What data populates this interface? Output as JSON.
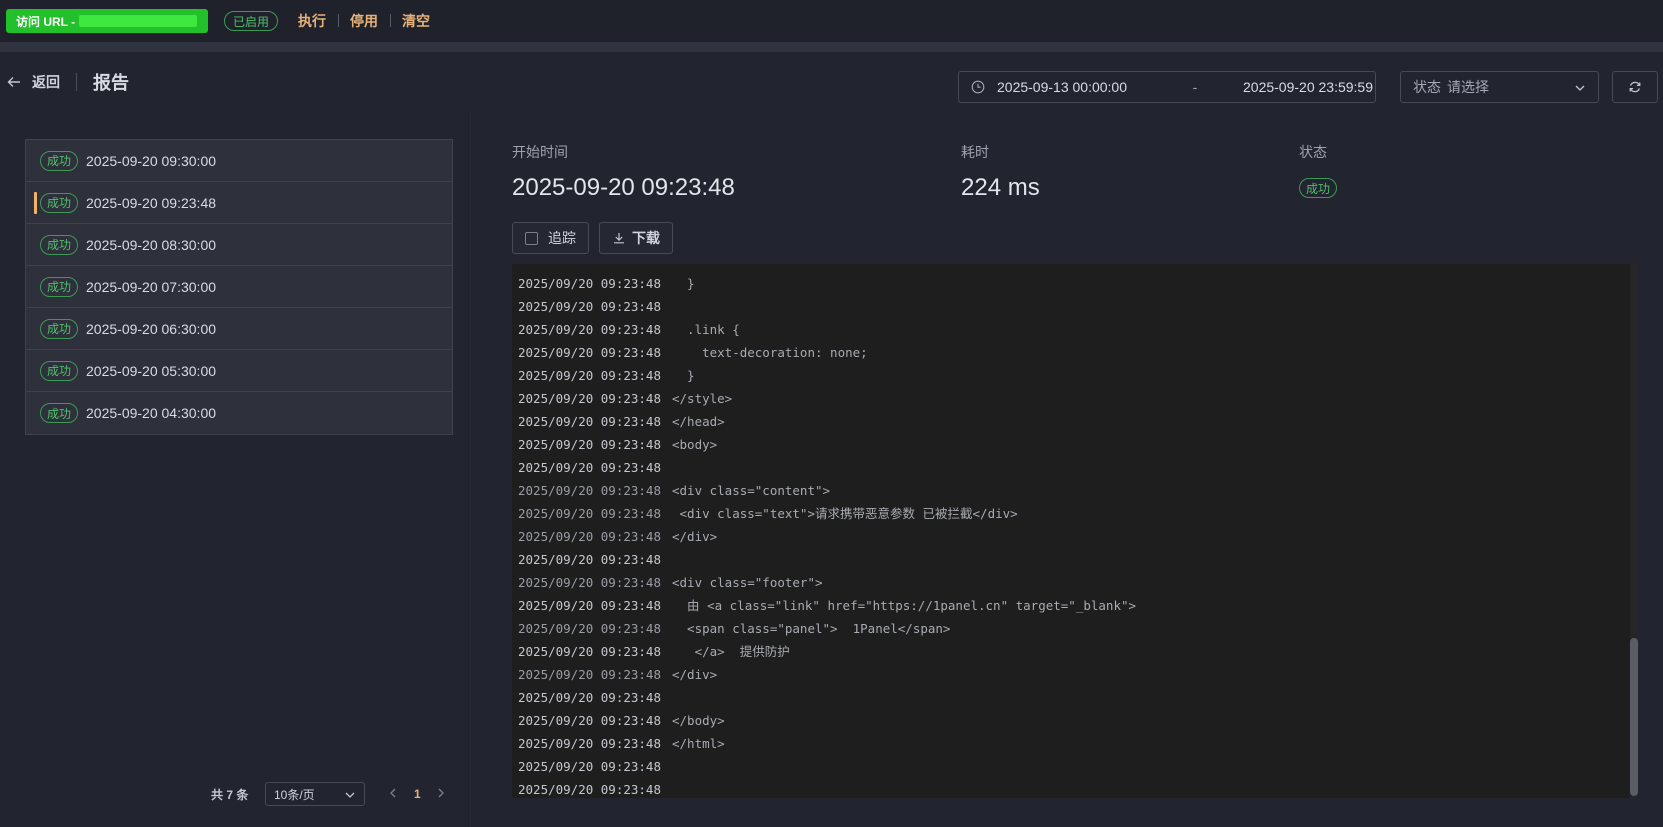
{
  "topbar": {
    "url_button": "访问 URL - ",
    "enabled_tag": "已启用",
    "actions": [
      "执行",
      "停用",
      "清空"
    ]
  },
  "header": {
    "back_label": "返回",
    "title": "报告",
    "date_start": "2025-09-13 00:00:00",
    "date_separator": "-",
    "date_end": "2025-09-20 23:59:59",
    "status_label": "状态",
    "status_placeholder": "请选择"
  },
  "records": [
    {
      "status": "成功",
      "time": "2025-09-20 09:30:00",
      "active": false
    },
    {
      "status": "成功",
      "time": "2025-09-20 09:23:48",
      "active": true
    },
    {
      "status": "成功",
      "time": "2025-09-20 08:30:00",
      "active": false
    },
    {
      "status": "成功",
      "time": "2025-09-20 07:30:00",
      "active": false
    },
    {
      "status": "成功",
      "time": "2025-09-20 06:30:00",
      "active": false
    },
    {
      "status": "成功",
      "time": "2025-09-20 05:30:00",
      "active": false
    },
    {
      "status": "成功",
      "time": "2025-09-20 04:30:00",
      "active": false
    }
  ],
  "pagination": {
    "total": "共 7 条",
    "page_size": "10条/页",
    "current_page": "1"
  },
  "details": {
    "start_label": "开始时间",
    "start_value": "2025-09-20 09:23:48",
    "duration_label": "耗时",
    "duration_value": "224 ms",
    "status_label": "状态",
    "status_value": "成功",
    "trace_label": "追踪",
    "download_label": "下载"
  },
  "log_lines": [
    {
      "ts": "2025/09/20 09:23:48",
      "text": "  }",
      "dim": false
    },
    {
      "ts": "2025/09/20 09:23:48",
      "text": "",
      "dim": false
    },
    {
      "ts": "2025/09/20 09:23:48",
      "text": "  .link {",
      "dim": false
    },
    {
      "ts": "2025/09/20 09:23:48",
      "text": "    text-decoration: none;",
      "dim": false
    },
    {
      "ts": "2025/09/20 09:23:48",
      "text": "  }",
      "dim": false
    },
    {
      "ts": "2025/09/20 09:23:48",
      "text": "</style>",
      "dim": false
    },
    {
      "ts": "2025/09/20 09:23:48",
      "text": "</head>",
      "dim": false
    },
    {
      "ts": "2025/09/20 09:23:48",
      "text": "<body>",
      "dim": false
    },
    {
      "ts": "2025/09/20 09:23:48",
      "text": "",
      "dim": false
    },
    {
      "ts": "2025/09/20 09:23:48",
      "text": "<div class=\"content\">",
      "dim": true
    },
    {
      "ts": "2025/09/20 09:23:48",
      "text": " <div class=\"text\">请求携带恶意参数 已被拦截</div>",
      "dim": true
    },
    {
      "ts": "2025/09/20 09:23:48",
      "text": "</div>",
      "dim": true
    },
    {
      "ts": "2025/09/20 09:23:48",
      "text": "",
      "dim": false
    },
    {
      "ts": "2025/09/20 09:23:48",
      "text": "<div class=\"footer\">",
      "dim": true
    },
    {
      "ts": "2025/09/20 09:23:48",
      "text": "  由 <a class=\"link\" href=\"https://1panel.cn\" target=\"_blank\">",
      "dim": false
    },
    {
      "ts": "2025/09/20 09:23:48",
      "text": "  <span class=\"panel\">  1Panel</span>",
      "dim": true
    },
    {
      "ts": "2025/09/20 09:23:48",
      "text": "   </a>  提供防护",
      "dim": false
    },
    {
      "ts": "2025/09/20 09:23:48",
      "text": "</div>",
      "dim": true
    },
    {
      "ts": "2025/09/20 09:23:48",
      "text": "",
      "dim": false
    },
    {
      "ts": "2025/09/20 09:23:48",
      "text": "</body>",
      "dim": false
    },
    {
      "ts": "2025/09/20 09:23:48",
      "text": "</html>",
      "dim": false
    },
    {
      "ts": "2025/09/20 09:23:48",
      "text": "",
      "dim": false
    },
    {
      "ts": "2025/09/20 09:23:48",
      "text": "",
      "dim": false
    }
  ],
  "colors": {
    "accent": "#e7b27a",
    "success": "#4fc06a",
    "url_button": "#22c02a",
    "background": "#22242f"
  },
  "icons": [
    "arrow-left-icon",
    "clock-icon",
    "chevron-down-icon",
    "refresh-icon",
    "download-icon",
    "chevron-left-icon",
    "chevron-right-icon"
  ]
}
